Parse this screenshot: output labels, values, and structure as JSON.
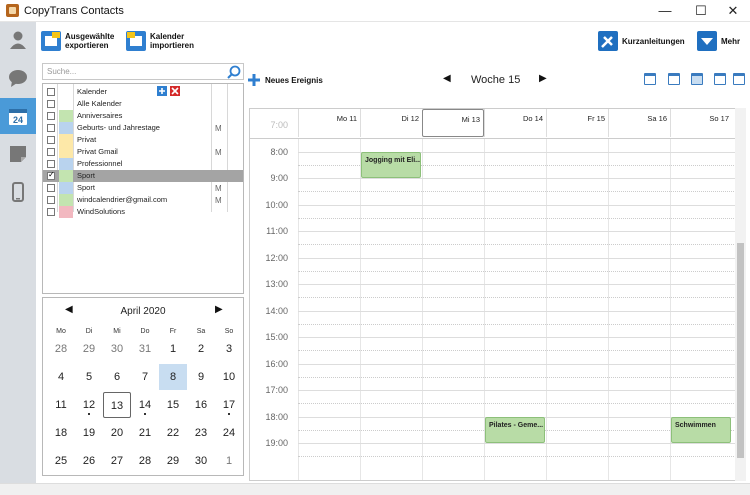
{
  "window": {
    "title": "CopyTrans Contacts",
    "minimize": "—",
    "maximize": "☐",
    "close": "✕"
  },
  "toolbar": {
    "export_selected": "Ausgewählte\nexportieren",
    "import_calendar": "Kalender\nimportieren",
    "new_event": "Neues Ereignis",
    "guides": "Kurzanleitungen",
    "more": "Mehr"
  },
  "search": {
    "placeholder": "Suche..."
  },
  "calendars": [
    {
      "name": "Kalender",
      "color": "",
      "checked": false,
      "gmail": false
    },
    {
      "name": "Alle Kalender",
      "color": "",
      "checked": false,
      "gmail": false
    },
    {
      "name": "Anniversaires",
      "color": "#c3e4b0",
      "checked": false,
      "gmail": false
    },
    {
      "name": "Geburts- und Jahrestage",
      "color": "#b9d3ee",
      "checked": false,
      "gmail": true
    },
    {
      "name": "Privat",
      "color": "#fde8a8",
      "checked": false,
      "gmail": false
    },
    {
      "name": "Privat Gmail",
      "color": "#fde8a8",
      "checked": false,
      "gmail": true
    },
    {
      "name": "Professionnel",
      "color": "#b9d3ee",
      "checked": false,
      "gmail": false
    },
    {
      "name": "Sport",
      "color": "#c3e4b0",
      "checked": true,
      "gmail": false,
      "selected": true
    },
    {
      "name": "Sport",
      "color": "#b9d3ee",
      "checked": false,
      "gmail": true
    },
    {
      "name": "windcalendrier@gmail.com",
      "color": "#c3e4b0",
      "checked": false,
      "gmail": true
    },
    {
      "name": "WindSolutions",
      "color": "#f2b8c0",
      "checked": false,
      "gmail": false
    }
  ],
  "mini_calendar": {
    "title": "April 2020",
    "prev": "◀",
    "next": "▶",
    "weekdays": [
      "Mo",
      "Di",
      "Mi",
      "Do",
      "Fr",
      "Sa",
      "So"
    ],
    "weeks": [
      [
        {
          "d": "28",
          "dim": true
        },
        {
          "d": "29",
          "dim": true
        },
        {
          "d": "30",
          "dim": true
        },
        {
          "d": "31",
          "dim": true
        },
        {
          "d": "1"
        },
        {
          "d": "2"
        },
        {
          "d": "3"
        }
      ],
      [
        {
          "d": "4"
        },
        {
          "d": "5"
        },
        {
          "d": "6"
        },
        {
          "d": "7"
        },
        {
          "d": "8",
          "sel": true
        },
        {
          "d": "9"
        },
        {
          "d": "10"
        }
      ],
      [
        {
          "d": "11"
        },
        {
          "d": "12",
          "dot": true
        },
        {
          "d": "13",
          "today": true
        },
        {
          "d": "14",
          "dot": true
        },
        {
          "d": "15"
        },
        {
          "d": "16"
        },
        {
          "d": "17",
          "dot": true
        }
      ],
      [
        {
          "d": "18"
        },
        {
          "d": "19"
        },
        {
          "d": "20"
        },
        {
          "d": "21"
        },
        {
          "d": "22"
        },
        {
          "d": "23"
        },
        {
          "d": "24"
        }
      ],
      [
        {
          "d": "25"
        },
        {
          "d": "26"
        },
        {
          "d": "27"
        },
        {
          "d": "28"
        },
        {
          "d": "29"
        },
        {
          "d": "30"
        },
        {
          "d": "1",
          "dim": true
        }
      ]
    ]
  },
  "week_view": {
    "label": "Woche 15",
    "prev": "◀",
    "next": "▶",
    "days": [
      "Mo 11",
      "Di 12",
      "Mi 13",
      "Do 14",
      "Fr 15",
      "Sa 16",
      "So 17"
    ],
    "today_index": 2,
    "hours": [
      "7:00",
      "8:00",
      "9:00",
      "10:00",
      "11:00",
      "12:00",
      "13:00",
      "14:00",
      "15:00",
      "16:00",
      "17:00",
      "18:00",
      "19:00"
    ],
    "events": [
      {
        "title": "Jogging mit Eli...",
        "day": 1,
        "start": 8.0,
        "end": 9.0
      },
      {
        "title": "Pilates - Geme...",
        "day": 3,
        "start": 18.0,
        "end": 19.0
      },
      {
        "title": "Schwimmen",
        "day": 6,
        "start": 18.0,
        "end": 19.0
      }
    ]
  },
  "colors": {
    "accent": "#4a9ad8",
    "event_green": "#b8dca6",
    "sidebar": "#d9dde2"
  }
}
